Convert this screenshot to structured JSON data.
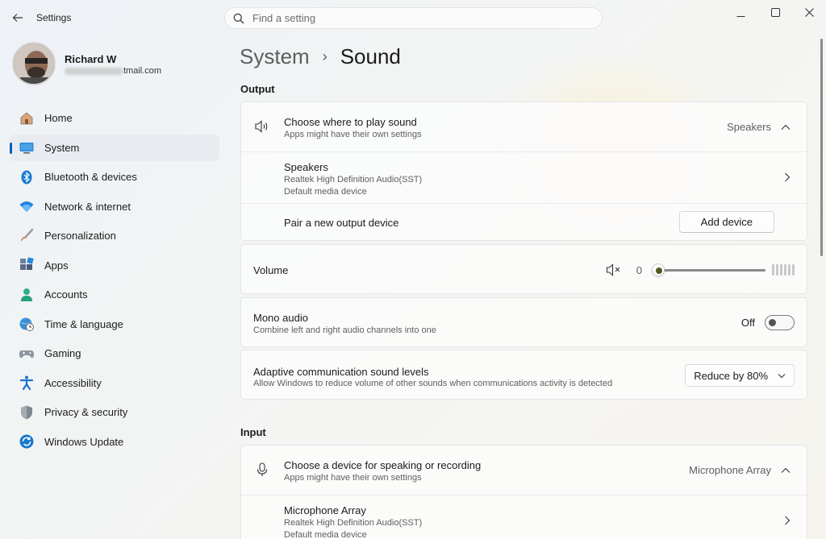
{
  "window": {
    "app_title": "Settings"
  },
  "search": {
    "placeholder": "Find a setting"
  },
  "profile": {
    "name": "Richard W",
    "email_visible": "tmail.com"
  },
  "sidebar": {
    "items": [
      {
        "label": "Home",
        "icon": "home-icon"
      },
      {
        "label": "System",
        "icon": "monitor-icon",
        "active": true
      },
      {
        "label": "Bluetooth & devices",
        "icon": "bluetooth-icon"
      },
      {
        "label": "Network & internet",
        "icon": "wifi-icon"
      },
      {
        "label": "Personalization",
        "icon": "brush-icon"
      },
      {
        "label": "Apps",
        "icon": "apps-icon"
      },
      {
        "label": "Accounts",
        "icon": "person-icon"
      },
      {
        "label": "Time & language",
        "icon": "globe-clock-icon"
      },
      {
        "label": "Gaming",
        "icon": "gamepad-icon"
      },
      {
        "label": "Accessibility",
        "icon": "accessibility-icon"
      },
      {
        "label": "Privacy & security",
        "icon": "shield-icon"
      },
      {
        "label": "Windows Update",
        "icon": "update-icon"
      }
    ]
  },
  "breadcrumb": {
    "parent": "System",
    "separator": "›",
    "current": "Sound"
  },
  "output": {
    "section_label": "Output",
    "choose": {
      "title": "Choose where to play sound",
      "subtitle": "Apps might have their own settings",
      "value": "Speakers"
    },
    "device": {
      "title": "Speakers",
      "line1": "Realtek High Definition Audio(SST)",
      "line2": "Default media device"
    },
    "pair": {
      "title": "Pair a new output device",
      "button": "Add device"
    },
    "volume": {
      "title": "Volume",
      "value": "0",
      "level": 0
    },
    "mono": {
      "title": "Mono audio",
      "subtitle": "Combine left and right audio channels into one",
      "state": "Off"
    },
    "adaptive": {
      "title": "Adaptive communication sound levels",
      "subtitle": "Allow Windows to reduce volume of other sounds when communications activity is detected",
      "value": "Reduce by 80%"
    }
  },
  "input": {
    "section_label": "Input",
    "choose": {
      "title": "Choose a device for speaking or recording",
      "subtitle": "Apps might have their own settings",
      "value": "Microphone Array"
    },
    "device": {
      "title": "Microphone Array",
      "line1": "Realtek High Definition Audio(SST)",
      "line2": "Default media device"
    }
  },
  "colors": {
    "accent": "#005fb8",
    "slider_thumb": "#535c1f"
  }
}
